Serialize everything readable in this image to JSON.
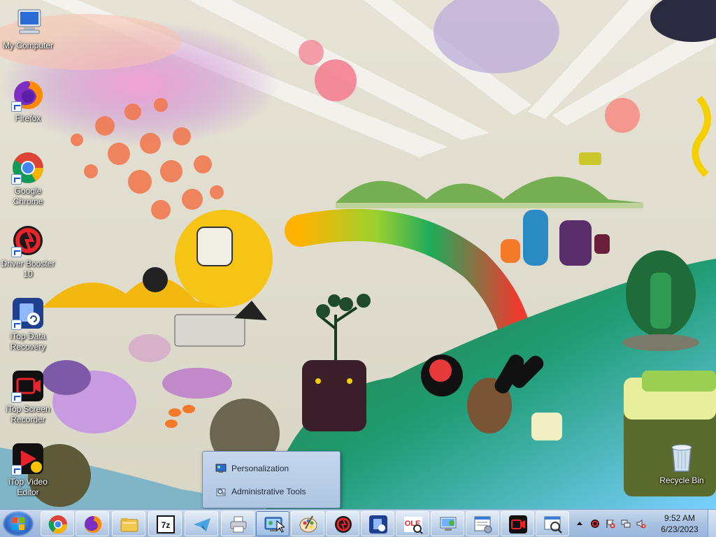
{
  "desktop": {
    "icons": [
      {
        "label": "My Computer"
      },
      {
        "label": "Firefox"
      },
      {
        "label": "Google Chrome"
      },
      {
        "label": "Driver Booster 10"
      },
      {
        "label": "iTop Data Recovery"
      },
      {
        "label": "iTop Screen Recorder"
      },
      {
        "label": "iTop Video Editor"
      },
      {
        "label": "Recycle Bin"
      }
    ]
  },
  "jumplist": {
    "items": [
      {
        "label": "Personalization",
        "icon": "personalization-icon"
      },
      {
        "label": "Administrative Tools",
        "icon": "admin-tools-icon"
      }
    ]
  },
  "taskbar": {
    "buttons": [
      {
        "name": "chrome",
        "icon": "chrome-icon"
      },
      {
        "name": "firefox",
        "icon": "firefox-icon"
      },
      {
        "name": "explorer",
        "icon": "folder-icon"
      },
      {
        "name": "7zip",
        "icon": "7zip-icon",
        "text": "7z"
      },
      {
        "name": "telegram",
        "icon": "paper-plane-icon"
      },
      {
        "name": "printer",
        "icon": "printer-icon"
      },
      {
        "name": "control-panel",
        "icon": "control-panel-icon"
      },
      {
        "name": "paint",
        "icon": "paint-palette-icon"
      },
      {
        "name": "driver-booster",
        "icon": "driver-booster-icon"
      },
      {
        "name": "itop-data-recovery",
        "icon": "data-recovery-icon"
      },
      {
        "name": "ole-viewer",
        "icon": "ole-viewer-icon",
        "text": "OLE"
      },
      {
        "name": "remote-desktop",
        "icon": "remote-desktop-icon"
      },
      {
        "name": "system-config",
        "icon": "system-config-icon"
      },
      {
        "name": "screen-recorder",
        "icon": "screen-recorder-icon"
      },
      {
        "name": "magnifier-tool",
        "icon": "magnifier-window-icon"
      }
    ],
    "clock": {
      "time": "9:52 AM",
      "date": "6/23/2023"
    }
  },
  "colors": {
    "taskbar": "#a9c2e2",
    "jumplist": "#c6d7ec",
    "accent": "#1d56b8"
  }
}
